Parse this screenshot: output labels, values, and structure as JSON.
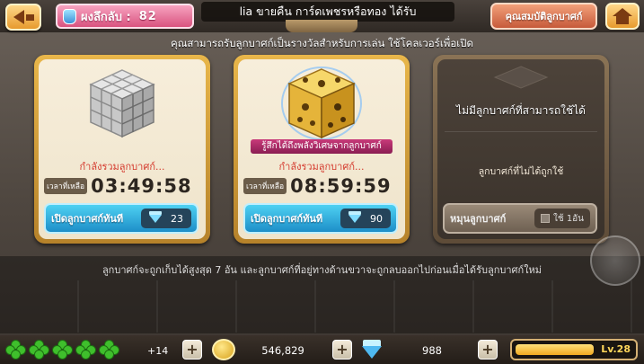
{
  "header": {
    "secret_label": "ผงลึกลับ :",
    "secret_value": "82",
    "marquee": "lia ขายคืน การ์ดเพชรหรือทอง ได้รับ",
    "properties_button": "คุณสมบัติลูกบาศก์"
  },
  "subtitle": "คุณสามารถรับลูกบาศก์เป็นรางวัลสำหรับการเล่น ใช้โคลเวอร์เพื่อเปิด",
  "cards": [
    {
      "cube_type": "silver",
      "status": "กำลังรวมลูกบาศก์...",
      "time_label": "เวลาที่เหลือ",
      "time": "03:49:58",
      "open_button": "เปิดลูกบาศก์ทันที",
      "cost": "23"
    },
    {
      "cube_type": "gold",
      "banner": "รู้สึกได้ถึงพลังวิเศษจากลูกบาศก์",
      "status": "กำลังรวมลูกบาศก์...",
      "time_label": "เวลาที่เหลือ",
      "time": "08:59:59",
      "open_button": "เปิดลูกบาศก์ทันที",
      "cost": "90"
    },
    {
      "cube_type": "empty",
      "title": "ไม่มีลูกบาศก์ที่สามารถใช้ได้",
      "subtitle": "ลูกบาศก์ที่ไม่ได้ถูกใช้",
      "spin_button": "หมุนลูกบาศก์",
      "spin_cost": "ใช้ 1อัน"
    }
  ],
  "info_text": "ลูกบาศก์จะถูกเก็บได้สูงสุด 7 อัน และลูกบาศก์ที่อยู่ทางด้านขวาจะถูกลบออกไปก่อนเมื่อได้รับลูกบาศก์ใหม่",
  "bottom": {
    "clover_count": 5,
    "clover_extra": "+14",
    "coins": "546,829",
    "gems": "988",
    "level": "Lv.28",
    "xp_fraction": 0.55
  },
  "colors": {
    "accent_gold": "#e8b64a",
    "button_blue": "#1d8ec8",
    "status_red": "#d43a2e"
  }
}
